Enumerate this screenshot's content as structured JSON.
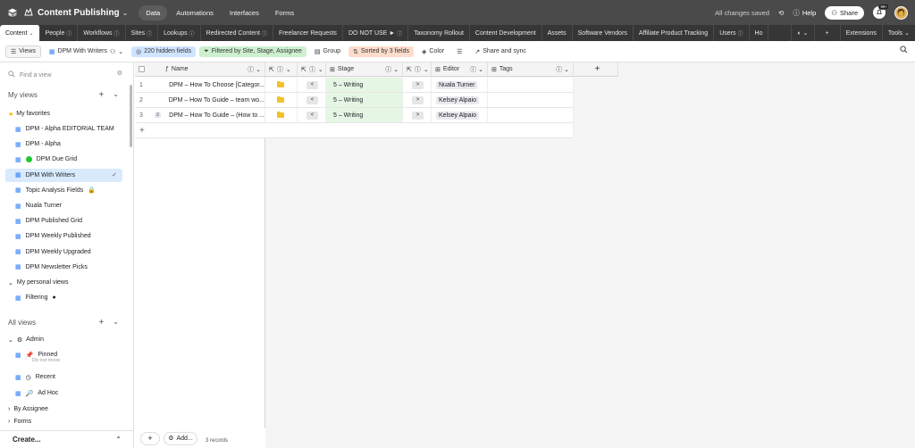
{
  "topbar": {
    "base_name": "Content Publishing",
    "base_caret": "⌄",
    "nav": [
      "Data",
      "Automations",
      "Interfaces",
      "Forms"
    ],
    "active_nav": "Data",
    "saved_status": "All changes saved",
    "help": "Help",
    "share": "Share",
    "notification_badge": "99+",
    "accent": "#4a4a4a"
  },
  "tabs": {
    "items": [
      {
        "label": "Content",
        "active": true,
        "extra": "⌄"
      },
      {
        "label": "People",
        "extra": "ⓘ"
      },
      {
        "label": "Workflows",
        "extra": "ⓘ"
      },
      {
        "label": "Sites",
        "extra": "ⓘ"
      },
      {
        "label": "Lookups",
        "extra": "ⓘ"
      },
      {
        "label": "Redirected Content",
        "extra": "ⓘ"
      },
      {
        "label": "Freelancer Requests",
        "extra": ""
      },
      {
        "label": "DO NOT USE ►",
        "extra": "ⓘ"
      },
      {
        "label": "Taxonomy Rollout",
        "extra": ""
      },
      {
        "label": "Content Development",
        "extra": ""
      },
      {
        "label": "Assets",
        "extra": ""
      },
      {
        "label": "Software Vendors",
        "extra": ""
      },
      {
        "label": "Affiliate Product Tracking",
        "extra": ""
      },
      {
        "label": "Users",
        "extra": "ⓘ"
      },
      {
        "label": "Ho",
        "extra": ""
      }
    ],
    "add": "+",
    "extensions": "Extensions",
    "tools": "Tools ⌄"
  },
  "toolbar": {
    "views": "Views",
    "current_view": "DPM With Writers",
    "hidden_fields": "220 hidden fields",
    "filter": "Filtered by Site, Stage, Assignee",
    "group": "Group",
    "sorted": "Sorted by 3 fields",
    "color": "Color",
    "share_sync": "Share and sync"
  },
  "sidebar": {
    "search_placeholder": "Find a view",
    "my_views": "My views",
    "my_favorites": "My favorites",
    "favorites": [
      {
        "label": "DPM - Alpha EDITORIAL TEAM"
      },
      {
        "label": "DPM - Alpha"
      },
      {
        "label": "DPM Due Grid"
      },
      {
        "label": "DPM With Writers",
        "selected": true
      },
      {
        "label": "Topic Analysis Fields"
      },
      {
        "label": "Nuala Turner"
      },
      {
        "label": "DPM Published Grid"
      },
      {
        "label": "DPM Weekly Published"
      },
      {
        "label": "DPM Weekly Upgraded"
      },
      {
        "label": "DPM Newsletter Picks"
      }
    ],
    "my_personal_views": "My personal views",
    "personal": [
      {
        "label": "Filtering"
      }
    ],
    "all_views": "All views",
    "admin": "Admin",
    "admin_items": [
      {
        "label": "Pinned",
        "sub": "Do not move"
      },
      {
        "label": "Recent"
      },
      {
        "label": "Ad Hoc"
      }
    ],
    "by_assignee": "By Assignee",
    "forms": "Forms",
    "create": "Create..."
  },
  "grid": {
    "columns": {
      "name": "Name",
      "stage": "Stage",
      "editor": "Editor",
      "tags": "Tags"
    },
    "rows": [
      {
        "num": "1",
        "name": "DPM – How To Choose [Categor...",
        "prev": "<",
        "stage": "5 – Writing",
        "next": ">",
        "editor": "Nuala Turner"
      },
      {
        "num": "2",
        "name": "DPM – How To Guide – team wo...",
        "prev": "<",
        "stage": "5 – Writing",
        "next": ">",
        "editor": "Kelsey Alpaio"
      },
      {
        "num": "3",
        "name": "DPM – How To Guide – (How to ...",
        "prev": "<",
        "stage": "5 – Writing",
        "next": ">",
        "editor": "Kelsey Alpaio",
        "comment": "2"
      }
    ],
    "add_row": "+",
    "add_column": "+",
    "footer_add": "+",
    "footer_addmore": "Add...",
    "records": "3 records"
  }
}
